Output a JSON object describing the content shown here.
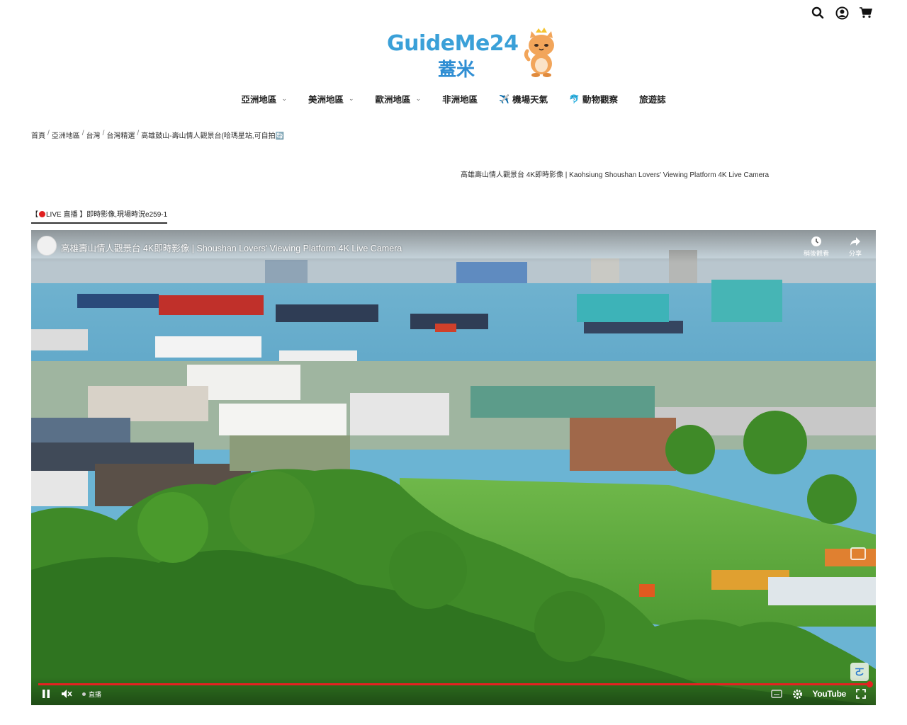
{
  "header": {
    "icons": [
      "search-icon",
      "user-icon",
      "cart-icon"
    ],
    "logo": {
      "brand": "GuideMe24",
      "sub": "蓋米"
    }
  },
  "nav": {
    "items": [
      {
        "label": "亞洲地區",
        "chevron": "⌄"
      },
      {
        "label": "美洲地區",
        "chevron": "⌄"
      },
      {
        "label": "歐洲地區",
        "chevron": "⌄"
      },
      {
        "label": "非洲地區",
        "chevron": ""
      },
      {
        "label": "機場天氣",
        "emoji": "✈️"
      },
      {
        "label": "動物觀察",
        "emoji": "🐬"
      },
      {
        "label": "旅遊誌",
        "chevron": ""
      }
    ]
  },
  "breadcrumb": {
    "items": [
      "首頁",
      "亞洲地區",
      "台灣",
      "台灣精選",
      "高雄鼓山-壽山情人觀景台(哈瑪星站,可自拍🔄"
    ],
    "separator": "/"
  },
  "caption": "高雄壽山情人觀景台 4K即時影像 | Kaohsiung Shoushan Lovers' Viewing Platform 4K Live Camera",
  "live_tab": {
    "prefix": "【",
    "label": "LIVE 直播 】即時影像,現場時況e259-1"
  },
  "video": {
    "title": "高雄壽山情人觀景台 4K即時影像 | Shoushan Lovers' Viewing Platform 4K Live Camera",
    "watch_later": "稍後觀看",
    "share": "分享",
    "live_label": "直播",
    "youtube_label": "YouTube",
    "progress": 1.0
  },
  "colors": {
    "accent_blue": "#3aa0d8",
    "live_red": "#e02020",
    "progress_red": "#e52121"
  }
}
